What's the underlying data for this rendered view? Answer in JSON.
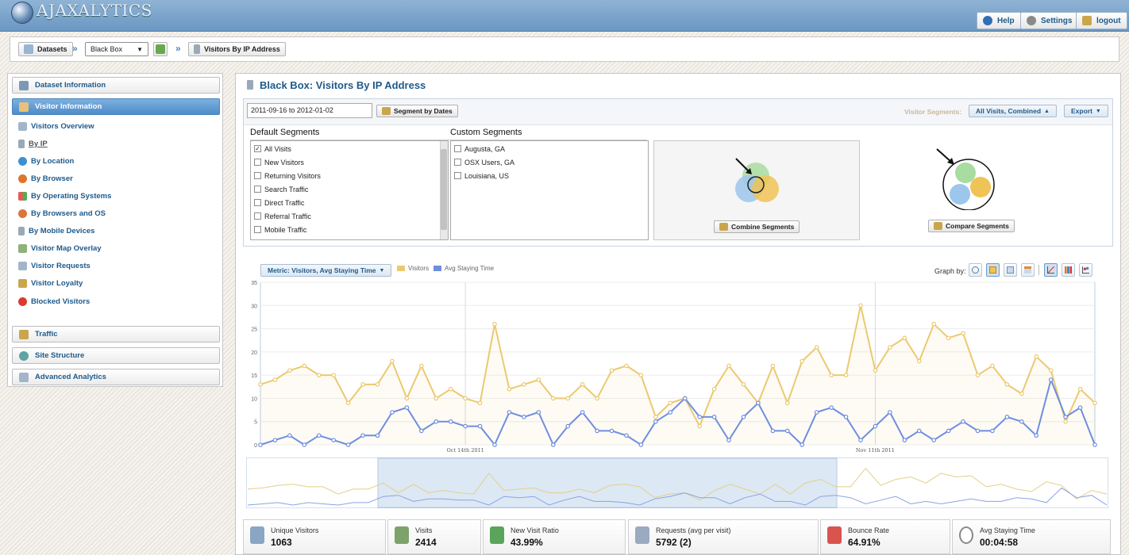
{
  "app": {
    "brand": "AJAXALYTICS"
  },
  "topnav": {
    "help": "Help",
    "settings": "Settings",
    "logout": "logout"
  },
  "breadcrumb": {
    "datasets": "Datasets",
    "dataset_selected": "Black Box",
    "current": "Visitors By IP Address"
  },
  "sidebar": {
    "sections": {
      "dataset_info": "Dataset Information",
      "visitor_info": "Visitor Information",
      "traffic": "Traffic",
      "site_structure": "Site Structure",
      "advanced": "Advanced Analytics"
    },
    "items": [
      {
        "label": "Visitors Overview",
        "icon": "chart-icon"
      },
      {
        "label": "By IP",
        "icon": "ip-icon"
      },
      {
        "label": "By Location",
        "icon": "globe-icon"
      },
      {
        "label": "By Browser",
        "icon": "browser-icon"
      },
      {
        "label": "By Operating Systems",
        "icon": "os-icon"
      },
      {
        "label": "By Browsers and OS",
        "icon": "browser-os-icon"
      },
      {
        "label": "By Mobile Devices",
        "icon": "mobile-icon"
      },
      {
        "label": "Visitor Map Overlay",
        "icon": "map-icon"
      },
      {
        "label": "Visitor Requests",
        "icon": "requests-icon"
      },
      {
        "label": "Visitor Loyalty",
        "icon": "loyalty-icon"
      },
      {
        "label": "Blocked Visitors",
        "icon": "blocked-icon"
      }
    ],
    "active_item": "By IP"
  },
  "page": {
    "title": "Black Box: Visitors By IP Address"
  },
  "segments": {
    "date_range": "2011-09-16 to 2012-01-02",
    "segment_by_dates": "Segment by Dates",
    "visitor_segments_label": "Visitor Segments:",
    "visitor_segments_value": "All Visits, Combined",
    "export": "Export",
    "default_title": "Default Segments",
    "custom_title": "Custom Segments",
    "default": [
      {
        "label": "All Visits",
        "checked": true
      },
      {
        "label": "New Visitors",
        "checked": false
      },
      {
        "label": "Returning Visitors",
        "checked": false
      },
      {
        "label": "Search Traffic",
        "checked": false
      },
      {
        "label": "Direct Traffic",
        "checked": false
      },
      {
        "label": "Referral Traffic",
        "checked": false
      },
      {
        "label": "Mobile Traffic",
        "checked": false
      }
    ],
    "custom": [
      {
        "label": "Augusta, GA",
        "checked": false
      },
      {
        "label": "OSX Users, GA",
        "checked": false
      },
      {
        "label": "Louisiana, US",
        "checked": false
      }
    ],
    "combine": "Combine Segments",
    "compare": "Compare Segments"
  },
  "graph": {
    "metric": "Metric: Visitors, Avg Staying Time",
    "graph_by": "Graph by:"
  },
  "chart_data": {
    "type": "line",
    "title": "",
    "ylim": [
      0,
      35
    ],
    "yticks": [
      0,
      5,
      10,
      15,
      20,
      25,
      30,
      35
    ],
    "x_tick_labels": [
      {
        "label": "Oct 14th 2011",
        "index": 14
      },
      {
        "label": "Nov 11th 2011",
        "index": 42
      }
    ],
    "grid": true,
    "legend_position": "top-left",
    "series": [
      {
        "name": "Visitors",
        "color": "#ebc96f",
        "values": [
          13,
          14,
          16,
          17,
          15,
          15,
          9,
          13,
          13,
          18,
          10,
          17,
          10,
          12,
          10,
          9,
          26,
          12,
          13,
          14,
          10,
          10,
          13,
          10,
          16,
          17,
          15,
          6,
          9,
          10,
          4,
          12,
          17,
          13,
          9,
          17,
          9,
          18,
          21,
          15,
          15,
          30,
          16,
          21,
          23,
          18,
          26,
          23,
          24,
          15,
          17,
          13,
          11,
          19,
          16,
          5,
          12,
          9
        ]
      },
      {
        "name": "Avg Staying Time",
        "color": "#6f8ee0",
        "values": [
          0,
          1,
          2,
          0,
          2,
          1,
          0,
          2,
          2,
          7,
          8,
          3,
          5,
          5,
          4,
          4,
          0,
          7,
          6,
          7,
          0,
          4,
          7,
          3,
          3,
          2,
          0,
          5,
          7,
          10,
          6,
          6,
          1,
          6,
          9,
          3,
          3,
          0,
          7,
          8,
          6,
          1,
          4,
          7,
          1,
          3,
          1,
          3,
          5,
          3,
          3,
          6,
          5,
          2,
          14,
          6,
          8,
          0
        ]
      }
    ]
  },
  "stats": [
    {
      "label": "Unique Visitors",
      "value": "1063",
      "icon": "unique-visitors-icon",
      "color": "#8aa6c4"
    },
    {
      "label": "Visits",
      "value": "2414",
      "icon": "visits-icon",
      "color": "#7ca36a"
    },
    {
      "label": "New Visit Ratio",
      "value": "43.99%",
      "icon": "new-visit-icon",
      "color": "#5aa55a"
    },
    {
      "label": "Requests (avg per visit)",
      "value": "5792 (2)",
      "icon": "requests-icon",
      "color": "#9aaac0"
    },
    {
      "label": "Bounce Rate",
      "value": "64.91%",
      "icon": "bounce-icon",
      "color": "#d9534f"
    },
    {
      "label": "Avg Staying Time",
      "value": "00:04:58",
      "icon": "clock-icon",
      "color": "#888888"
    }
  ]
}
